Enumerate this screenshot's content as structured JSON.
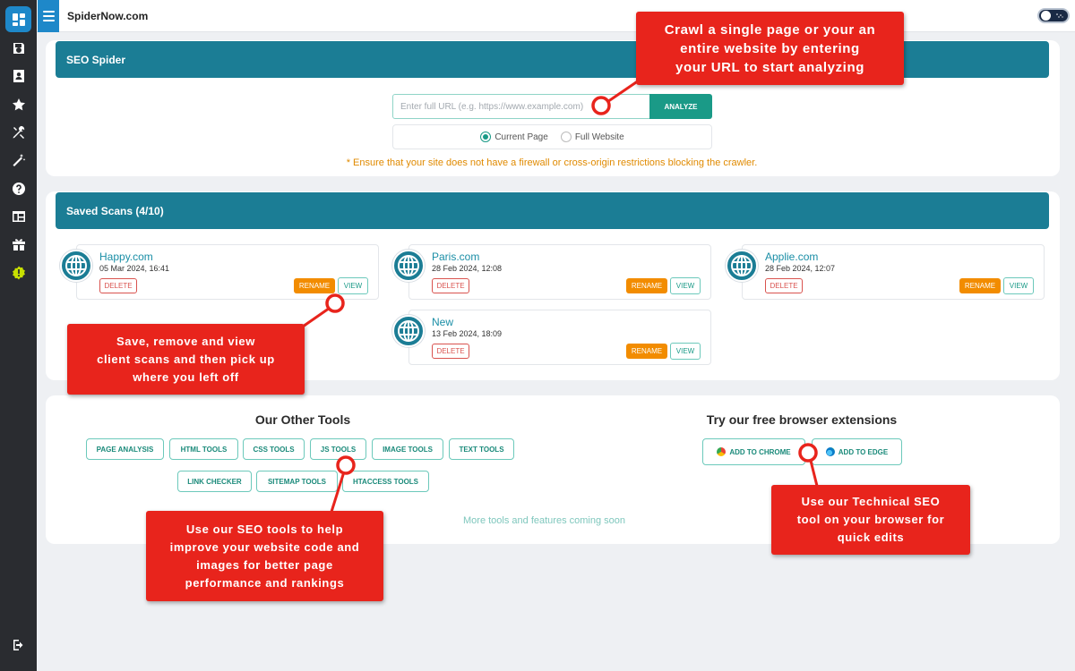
{
  "app": {
    "site_title": "SpiderNow.com"
  },
  "sidebar": {
    "items": [
      {
        "icon": "dashboard-icon",
        "active": true
      },
      {
        "icon": "save-icon"
      },
      {
        "icon": "contact-card-icon"
      },
      {
        "icon": "star-icon"
      },
      {
        "icon": "tools-icon"
      },
      {
        "icon": "magic-wand-icon"
      },
      {
        "icon": "help-icon"
      },
      {
        "icon": "layout-icon"
      },
      {
        "icon": "gift-icon"
      },
      {
        "icon": "alert-badge-icon"
      }
    ],
    "logout_icon": "logout-icon"
  },
  "seo_spider": {
    "header": "SEO Spider",
    "url_placeholder": "Enter full URL (e.g. https://www.example.com)",
    "url_value": "",
    "analyze_label": "ANALYZE",
    "scope_options": [
      "Current Page",
      "Full Website"
    ],
    "scope_selected": "Current Page",
    "warning": "* Ensure that your site does not have a firewall or cross-origin restrictions blocking the crawler."
  },
  "saved_scans": {
    "header": "Saved Scans (4/10)",
    "delete_label": "DELETE",
    "rename_label": "RENAME",
    "view_label": "VIEW",
    "items": [
      {
        "name": "Happy.com",
        "date": "05 Mar 2024, 16:41"
      },
      {
        "name": "Paris.com",
        "date": "28 Feb 2024, 12:08"
      },
      {
        "name": "Applie.com",
        "date": "28 Feb 2024, 12:07"
      },
      {
        "name": "New",
        "date": "13 Feb 2024, 18:09"
      }
    ]
  },
  "other_tools": {
    "title": "Our Other Tools",
    "buttons": [
      "PAGE ANALYSIS",
      "HTML TOOLS",
      "CSS TOOLS",
      "JS TOOLS",
      "IMAGE TOOLS",
      "TEXT TOOLS",
      "LINK CHECKER",
      "SITEMAP TOOLS",
      "HTACCESS TOOLS"
    ],
    "more": "More tools and features coming soon"
  },
  "extensions": {
    "title": "Try our free browser extensions",
    "chrome_label": "ADD TO CHROME",
    "edge_label": "ADD TO EDGE"
  },
  "callouts": {
    "crawl": "Crawl a single page or your an\nentire website by entering\nyour URL  to start analyzing",
    "scans": "Save, remove and view\nclient scans and then pick up\nwhere you left off",
    "tools": "Use our SEO tools to help\nimprove your website code and\nimages for better page\nperformance and rankings",
    "extension": "Use our Technical SEO\ntool on your browser for\nquick edits"
  },
  "colors": {
    "header_teal": "#1b7d95",
    "accent_green": "#1a9a87",
    "rename_orange": "#f28c00",
    "delete_red": "#d9534f",
    "callout_red": "#e8241c",
    "warning_orange": "#e08a00"
  }
}
